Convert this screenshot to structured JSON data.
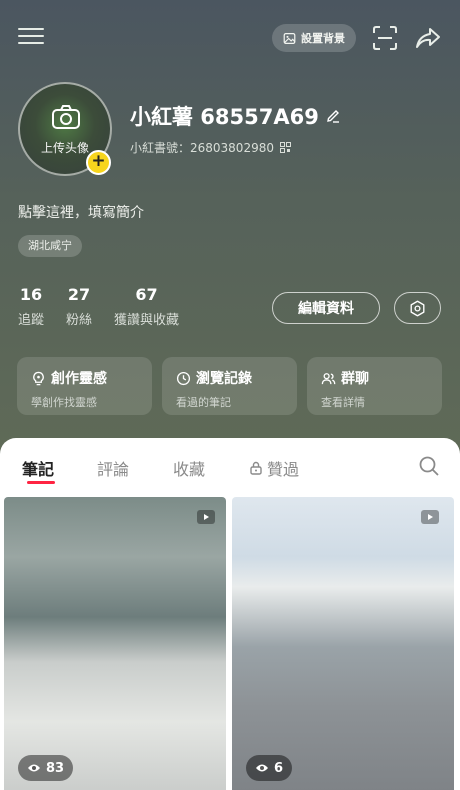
{
  "header": {
    "set_background_label": "設置背景"
  },
  "profile": {
    "avatar_upload_label": "上传头像",
    "username": "小紅薯 68557A69",
    "user_id": "小紅書號：26803802980",
    "bio_placeholder": "點擊這裡，填寫簡介",
    "location_tag": "湖北咸宁"
  },
  "stats": [
    {
      "value": "16",
      "label": "追蹤"
    },
    {
      "value": "27",
      "label": "粉絲"
    },
    {
      "value": "67",
      "label": "獲讚與收藏"
    }
  ],
  "actions": {
    "edit_profile_label": "編輯資料"
  },
  "cards": [
    {
      "title": "創作靈感",
      "subtitle": "學創作找靈感",
      "icon": "bulb-icon"
    },
    {
      "title": "瀏覽記錄",
      "subtitle": "看過的筆記",
      "icon": "clock-icon"
    },
    {
      "title": "群聊",
      "subtitle": "查看詳情",
      "icon": "group-icon"
    }
  ],
  "tabs": [
    {
      "label": "筆記",
      "active": true
    },
    {
      "label": "評論",
      "active": false
    },
    {
      "label": "收藏",
      "active": false
    },
    {
      "label": "贊過",
      "active": false,
      "icon": "lock-icon"
    }
  ],
  "notes": [
    {
      "views": "83",
      "type": "video"
    },
    {
      "views": "6",
      "type": "video"
    }
  ],
  "colors": {
    "accent": "#ff2442",
    "badge": "#f7d51d"
  }
}
